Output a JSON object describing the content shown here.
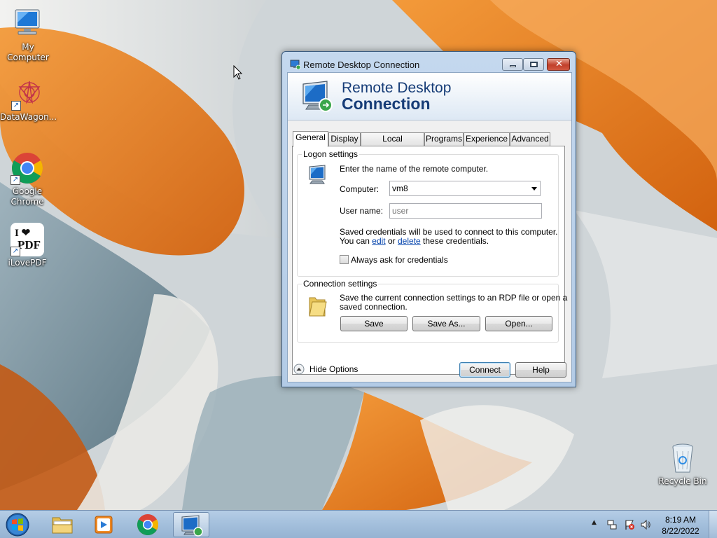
{
  "desktop": {
    "icons": [
      {
        "label": "My Computer",
        "icon": "computer-icon"
      },
      {
        "label": "DataWagon...",
        "icon": "datawagon-icon"
      },
      {
        "label": "Google Chrome",
        "icon": "chrome-icon"
      },
      {
        "label": "iLovePDF",
        "icon": "ilovepdf-icon"
      },
      {
        "label": "Recycle Bin",
        "icon": "recycle-bin-icon"
      }
    ],
    "ilovepdf_glyph_top": "I ❤",
    "ilovepdf_glyph_bottom": "PDF"
  },
  "window": {
    "title": "Remote Desktop Connection",
    "banner_line1": "Remote Desktop",
    "banner_line2": "Connection",
    "tabs": [
      {
        "label": "General",
        "active": true
      },
      {
        "label": "Display",
        "active": false
      },
      {
        "label": "Local Resources",
        "active": false
      },
      {
        "label": "Programs",
        "active": false
      },
      {
        "label": "Experience",
        "active": false
      },
      {
        "label": "Advanced",
        "active": false
      }
    ],
    "logon": {
      "group_label": "Logon settings",
      "instruction": "Enter the name of the remote computer.",
      "computer_label": "Computer:",
      "computer_value": "vm8",
      "username_label": "User name:",
      "username_placeholder": "user",
      "creds_line1": "Saved credentials will be used to connect to this computer.",
      "creds_line2_prefix": "You can",
      "edit_link": "edit",
      "creds_or": "or",
      "delete_link": "delete",
      "creds_line2_suffix": "these credentials.",
      "always_ask_label": "Always ask for credentials",
      "always_ask_checked": false
    },
    "connection": {
      "group_label": "Connection settings",
      "description_line1": "Save the current connection settings to an RDP file or open a",
      "description_line2": "saved connection.",
      "save_label": "Save",
      "save_as_label": "Save As...",
      "open_label": "Open..."
    },
    "footer": {
      "hide_options_label": "Hide Options",
      "connect_label": "Connect",
      "help_label": "Help"
    }
  },
  "taskbar": {
    "time": "8:19 AM",
    "date": "8/22/2022",
    "pinned": [
      "start-orb-icon",
      "file-explorer-icon",
      "media-player-icon",
      "chrome-icon",
      "remote-desktop-icon"
    ]
  },
  "colors": {
    "accent_orange": "#e77b1c",
    "banner_text": "#163c77",
    "link": "#0645ad"
  }
}
